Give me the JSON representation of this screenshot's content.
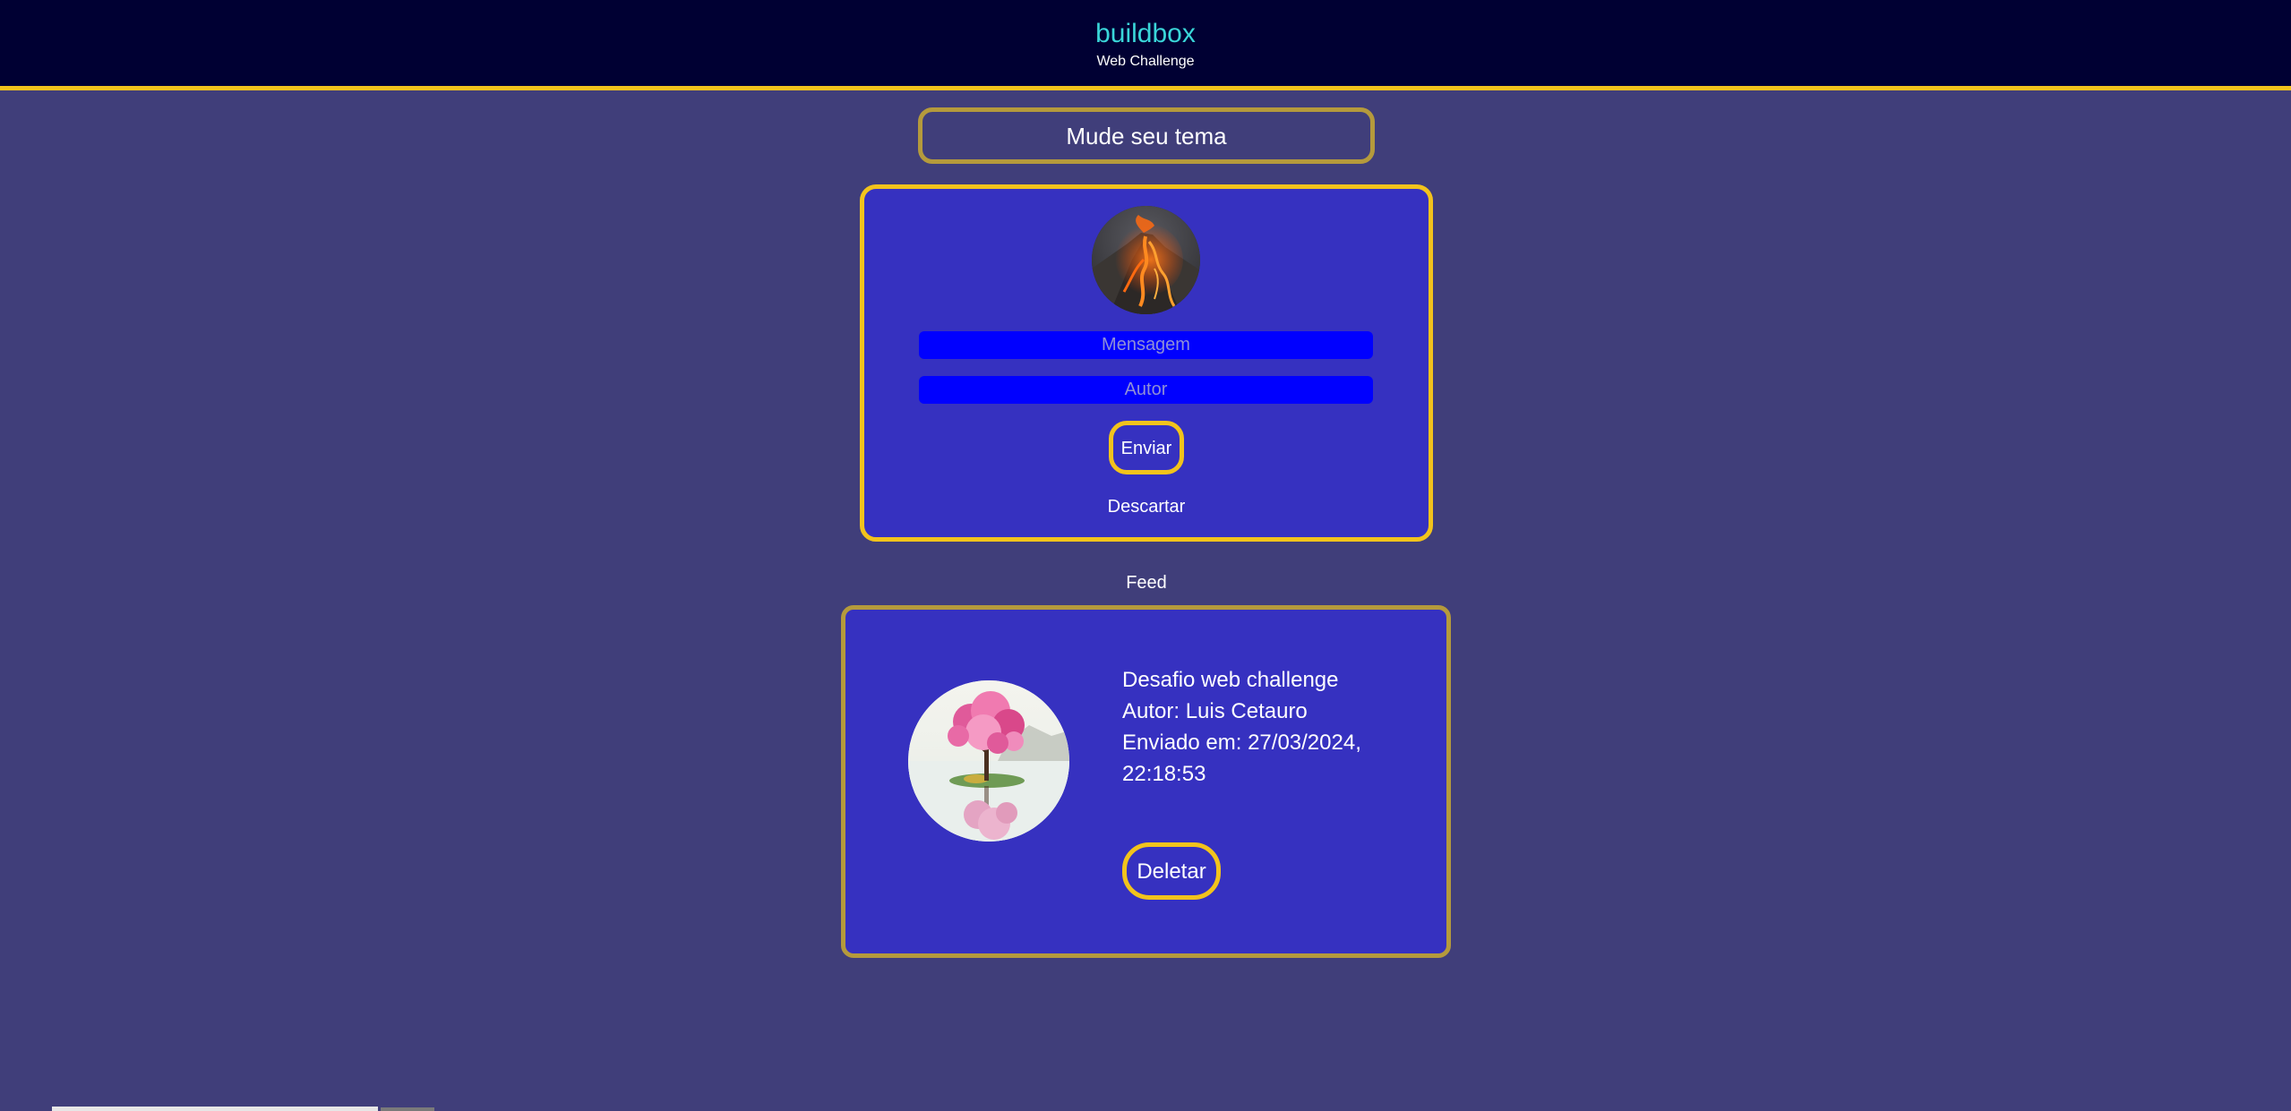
{
  "header": {
    "title": "buildbox",
    "subtitle": "Web Challenge"
  },
  "theme": {
    "button_label": "Mude seu tema"
  },
  "compose": {
    "avatar_icon": "volcano-lava-image",
    "message_placeholder": "Mensagem",
    "message_value": "",
    "author_placeholder": "Autor",
    "author_value": "",
    "send_label": "Enviar",
    "discard_label": "Descartar"
  },
  "feed": {
    "label": "Feed",
    "posts": [
      {
        "image_icon": "cherry-blossom-tree-image",
        "message": "Desafio web challenge",
        "author_line": "Autor: Luis Cetauro",
        "date_line_1": "Enviado em: 27/03/2024,",
        "date_line_2": "22:18:53",
        "delete_label": "Deletar"
      }
    ]
  },
  "colors": {
    "background": "#403e7a",
    "header_bg": "#000033",
    "accent_yellow": "#f2c31c",
    "muted_gold": "#b59a3c",
    "card_bg": "#3631c0",
    "input_bg": "#0000ff",
    "brand_cyan": "#3ad6d9"
  }
}
